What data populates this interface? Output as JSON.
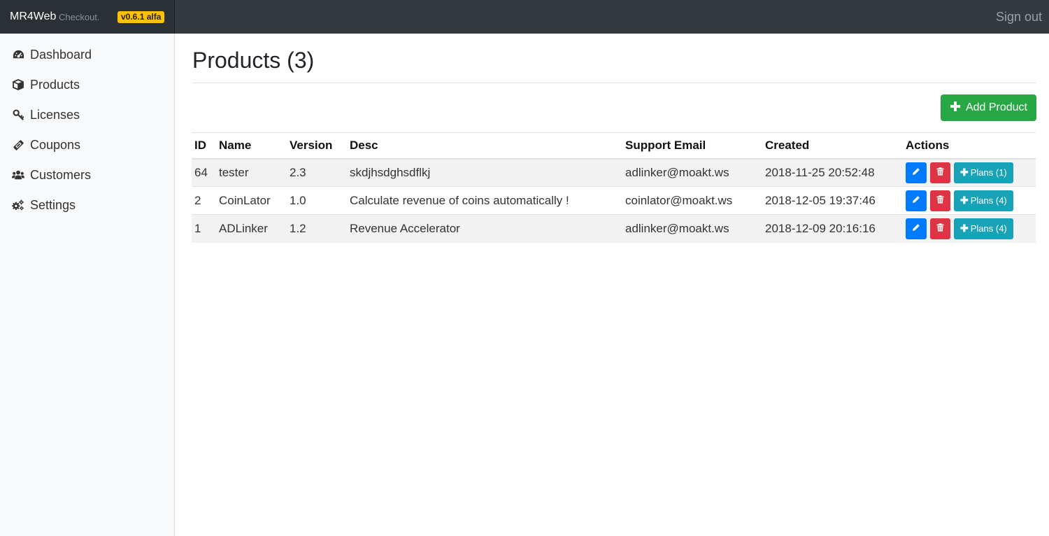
{
  "header": {
    "brand": "MR4Web",
    "brand_sub": "Checkout.",
    "version": "v0.6.1 alfa",
    "signout": "Sign out"
  },
  "sidebar": {
    "items": [
      {
        "label": "Dashboard",
        "icon": "dashboard-icon"
      },
      {
        "label": "Products",
        "icon": "box-icon"
      },
      {
        "label": "Licenses",
        "icon": "key-icon"
      },
      {
        "label": "Coupons",
        "icon": "ticket-icon"
      },
      {
        "label": "Customers",
        "icon": "users-icon"
      },
      {
        "label": "Settings",
        "icon": "gears-icon"
      }
    ]
  },
  "main": {
    "title": "Products (3)",
    "add_button": "Add Product",
    "table": {
      "headers": [
        "ID",
        "Name",
        "Version",
        "Desc",
        "Support Email",
        "Created",
        "Actions"
      ],
      "rows": [
        {
          "id": "64",
          "name": "tester",
          "version": "2.3",
          "desc": "skdjhsdghsdflkj",
          "email": "adlinker@moakt.ws",
          "created": "2018-11-25 20:52:48",
          "plans": "Plans (1)"
        },
        {
          "id": "2",
          "name": "CoinLator",
          "version": "1.0",
          "desc": "Calculate revenue of coins automatically !",
          "email": "coinlator@moakt.ws",
          "created": "2018-12-05 19:37:46",
          "plans": "Plans (4)"
        },
        {
          "id": "1",
          "name": "ADLinker",
          "version": "1.2",
          "desc": "Revenue Accelerator",
          "email": "adlinker@moakt.ws",
          "created": "2018-12-09 20:16:16",
          "plans": "Plans (4)"
        }
      ]
    }
  },
  "colors": {
    "topbar": "#343a40",
    "success": "#28a745",
    "primary": "#007bff",
    "danger": "#dc3545",
    "info": "#17a2b8",
    "warning": "#ffc107"
  }
}
